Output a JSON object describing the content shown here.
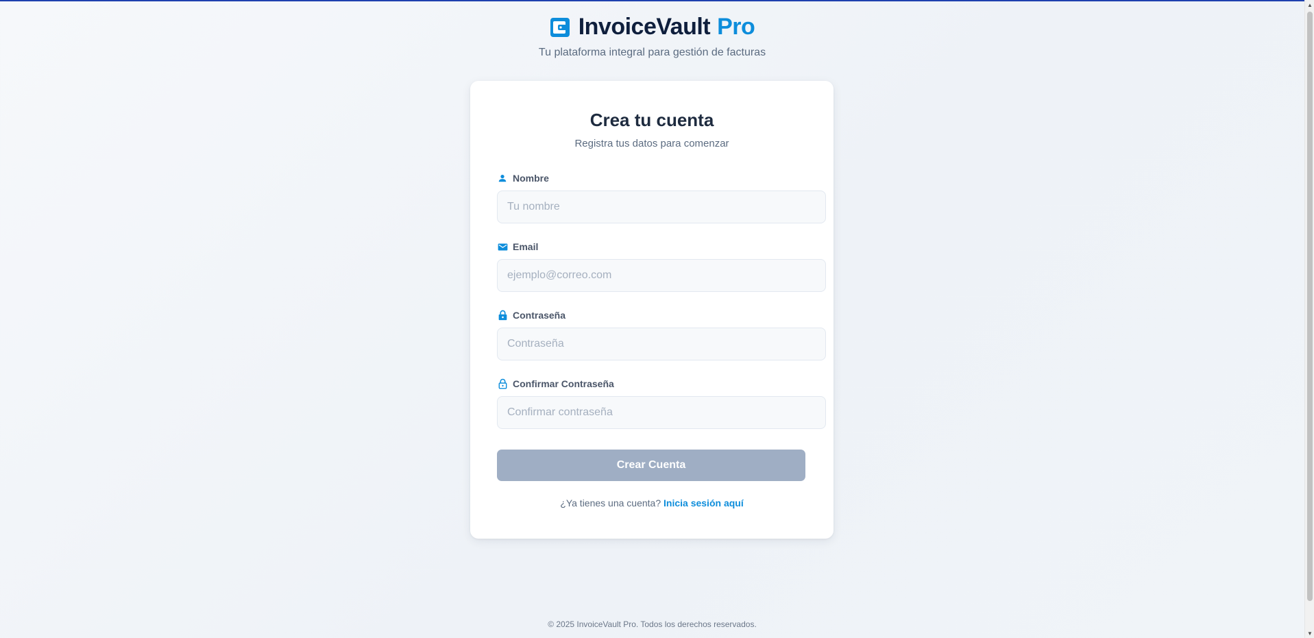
{
  "colors": {
    "brand_dark": "#0f1f3d",
    "brand_accent": "#0d8ddb",
    "button_disabled": "#9faec4",
    "top_accent": "#1e40af"
  },
  "header": {
    "logo_icon": "wallet-icon",
    "brand_name": "InvoiceVault",
    "brand_suffix": "Pro",
    "tagline": "Tu plataforma integral para gestión de facturas"
  },
  "form": {
    "title": "Crea tu cuenta",
    "subtitle": "Registra tus datos para comenzar",
    "fields": [
      {
        "label": "Nombre",
        "icon": "person-icon",
        "placeholder": "Tu nombre",
        "value": ""
      },
      {
        "label": "Email",
        "icon": "mail-icon",
        "placeholder": "ejemplo@correo.com",
        "value": ""
      },
      {
        "label": "Contraseña",
        "icon": "lock-icon",
        "placeholder": "Contraseña",
        "value": ""
      },
      {
        "label": "Confirmar Contraseña",
        "icon": "lock-open-icon",
        "placeholder": "Confirmar contraseña",
        "value": ""
      }
    ],
    "submit_label": "Crear Cuenta",
    "login_prompt": "¿Ya tienes una cuenta?",
    "login_link": "Inicia sesión aquí"
  },
  "footer": {
    "copyright": "© 2025 InvoiceVault Pro. Todos los derechos reservados."
  }
}
